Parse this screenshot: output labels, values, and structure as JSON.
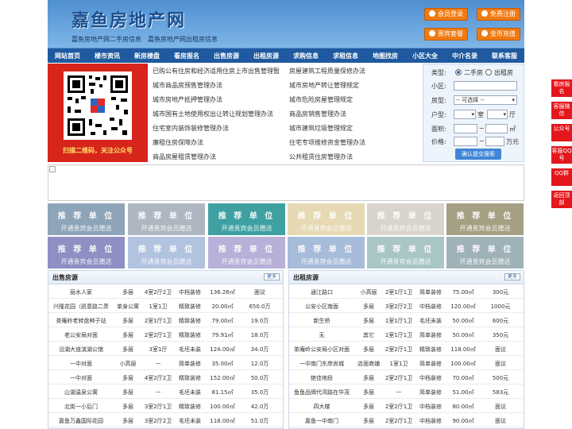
{
  "header": {
    "site_title": "嘉鱼房地产网",
    "sub_links": [
      "嘉鱼房地产网二手房信息",
      "嘉鱼房地产网出租房信息"
    ],
    "buttons": [
      "会员登录",
      "免费注册",
      "贵宾套餐",
      "金币充值"
    ]
  },
  "nav": [
    "网站首页",
    "楼市资讯",
    "新房楼盘",
    "看房报名",
    "出售房源",
    "出租房源",
    "求购信息",
    "求租信息",
    "地图找房",
    "小区大全",
    "中介名录",
    "联系客服"
  ],
  "qr": {
    "caption": "扫描二维码，关注公众号"
  },
  "links": {
    "left": [
      "已购公有住房和经济适用住房上市出售管理暂",
      "城市商品房预售管理办法",
      "城市房地产抵押管理办法",
      "城市国有土地使用权出让转让规划管理办法",
      "住宅室内装饰装修管理办法",
      "廉租住房保障办法",
      "商品房屋租赁管理办法"
    ],
    "right": [
      "房屋建筑工程质量保修办法",
      "城市房地产转让管理规定",
      "城市危险房屋管理规定",
      "商品房销售管理办法",
      "城市建筑垃圾管理规定",
      "住宅专项维修资金管理办法",
      "公共租赁住房管理办法"
    ]
  },
  "search": {
    "type_label": "类型:",
    "type_options": [
      "二手房",
      "出租房"
    ],
    "community_label": "小区:",
    "house_label": "房型:",
    "house_select": "-- 可选择 --",
    "layout_label": "户型:",
    "room_unit": "室",
    "hall_unit": "厅",
    "area_label": "面积:",
    "area_unit": "㎡",
    "price_label": "价格:",
    "price_unit": "万元",
    "range_sep": "~",
    "submit": "确认提交搜索"
  },
  "ads": {
    "title": "推 荐 单 位",
    "subtitle": "开通贵宾会员赠送",
    "colors": [
      "#8ea4b8",
      "#aeb7c0",
      "#3fa0a2",
      "#e6d9b4",
      "#d9d4cc",
      "#a59f83",
      "#8f8fc4",
      "#b2c3e0",
      "#b7b0d8",
      "#a7bcd8",
      "#a9c6c5",
      "#9fb2b8"
    ]
  },
  "sale": {
    "title": "出售房源",
    "more": "更多",
    "rows": [
      [
        "丽水人家",
        "多层",
        "4室2厅2卫",
        "中档装修",
        "136.26㎡",
        "面议"
      ],
      [
        "兴隆花园（凯意路二弄",
        "单身公寓",
        "1室1卫",
        "精致装修",
        "20.00㎡",
        "650.0万"
      ],
      [
        "茶庵岭老转盘种子站",
        "多层",
        "2室1厅1卫",
        "精致装修",
        "79.00㎡",
        "19.0万"
      ],
      [
        "老公安局对面",
        "多层",
        "2室2厅1卫",
        "精致装修",
        "79.91㎡",
        "18.0万"
      ],
      [
        "沿湖大道滨湖公馆",
        "多层",
        "3室1厅",
        "毛坯未装",
        "124.00㎡",
        "34.0万"
      ],
      [
        "一中对面",
        "小高层",
        "—",
        "简单装修",
        "35.00㎡",
        "12.0万"
      ],
      [
        "一中对面",
        "多层",
        "4室2厅2卫",
        "精致装修",
        "152.00㎡",
        "50.0万"
      ],
      [
        "山湖温泉公寓",
        "多层",
        "—",
        "毛坯未装",
        "81.15㎡",
        "35.0万"
      ],
      [
        "北街一小后门",
        "多层",
        "3室2厅1卫",
        "精致装修",
        "100.00㎡",
        "42.0万"
      ],
      [
        "嘉鱼万鑫国际花园",
        "多层",
        "3室2厅2卫",
        "毛坯未装",
        "118.00㎡",
        "51.0万"
      ]
    ]
  },
  "rent": {
    "title": "出租房源",
    "more": "更多",
    "rows": [
      [
        "通江路口",
        "小高层",
        "2室1厅1卫",
        "简单装修",
        "75.00㎡",
        "300元"
      ],
      [
        "公安小区南面",
        "多层",
        "3室2厅2卫",
        "中档装修",
        "120.00㎡",
        "1000元"
      ],
      [
        "新生桥",
        "多层",
        "1室1厅1卫",
        "毛坯未装",
        "50.00㎡",
        "600元"
      ],
      [
        "无",
        "其它",
        "1室1厅1卫",
        "简单装修",
        "50.00㎡",
        "350元"
      ],
      [
        "茶庵岭公安局小区对面",
        "多层",
        "2室2厅1卫",
        "精致装修",
        "118.00㎡",
        "面议"
      ],
      [
        "一中南门东岸尚城",
        "店面商铺",
        "1室1卫",
        "简单装修",
        "100.00㎡",
        "面议"
      ],
      [
        "绝佳地段",
        "多层",
        "2室2厅1卫",
        "中档装修",
        "70.00㎡",
        "500元"
      ],
      [
        "鱼鱼品牌代湾路在华茂",
        "多层",
        "—",
        "简单装修",
        "51.00㎡",
        "583元"
      ],
      [
        "四大楼",
        "多层",
        "2室2厅1卫",
        "中档装修",
        "80.00㎡",
        "面议"
      ],
      [
        "嘉鱼一中南门",
        "多层",
        "2室2厅1卫",
        "中档装修",
        "90.00㎡",
        "面议"
      ]
    ]
  },
  "side_float": [
    "看房报名",
    "客服微信",
    "公众号",
    "客服QQ号",
    "QQ群",
    "返回顶部"
  ]
}
